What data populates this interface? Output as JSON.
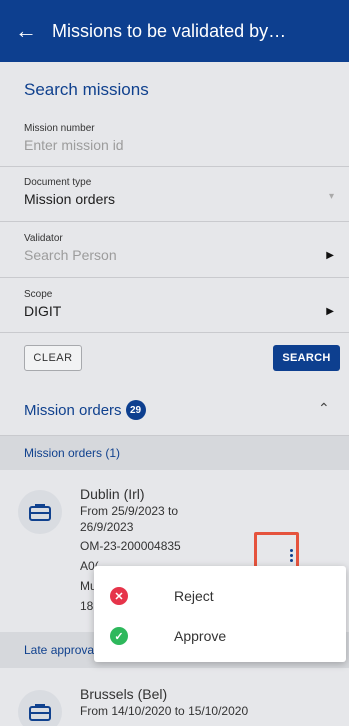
{
  "header": {
    "back_icon": "arrow-left-icon",
    "title": "Missions to be validated by…"
  },
  "search": {
    "title": "Search missions",
    "mission_number": {
      "label": "Mission number",
      "placeholder": "Enter mission id"
    },
    "document_type": {
      "label": "Document type",
      "value": "Mission orders"
    },
    "validator": {
      "label": "Validator",
      "placeholder": "Search Person"
    },
    "scope": {
      "label": "Scope",
      "value": "DIGIT"
    },
    "clear_label": "CLEAR",
    "search_label": "SEARCH"
  },
  "results": {
    "title": "Mission orders",
    "count": "29",
    "section1": "Mission orders (1)",
    "section2": "Late approva",
    "card1": {
      "city": "Dublin (Irl)",
      "dates": "From 25/9/2023 to",
      "dates2": "26/9/2023",
      "ref": "OM-23-200004835",
      "line4": "A0(",
      "line5": "Mu",
      "line6": "18("
    },
    "card2": {
      "city": "Brussels (Bel)",
      "dates": "From 14/10/2020 to 15/10/2020"
    }
  },
  "menu": {
    "reject": "Reject",
    "approve": "Approve"
  },
  "colors": {
    "primary": "#0d3f8f",
    "reject": "#e6344a",
    "approve": "#2eb85c",
    "highlight": "#e5533d"
  }
}
